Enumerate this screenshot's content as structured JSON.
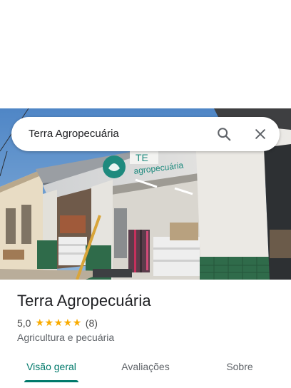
{
  "search": {
    "query": "Terra Agropecuária",
    "search_icon": "search-icon",
    "close_icon": "close-icon"
  },
  "photo": {
    "sign_text": "agropecuária",
    "sign_partial": "TE"
  },
  "place": {
    "name": "Terra Agropecuária",
    "rating": "5,0",
    "stars": 5,
    "review_count": "(8)",
    "category": "Agricultura e pecuária"
  },
  "tabs": [
    {
      "label": "Visão geral",
      "active": true
    },
    {
      "label": "Avaliações",
      "active": false
    },
    {
      "label": "Sobre",
      "active": false
    }
  ],
  "colors": {
    "accent": "#00796b",
    "star": "#f9ab00",
    "text_primary": "#202124",
    "text_secondary": "#5f6368"
  }
}
